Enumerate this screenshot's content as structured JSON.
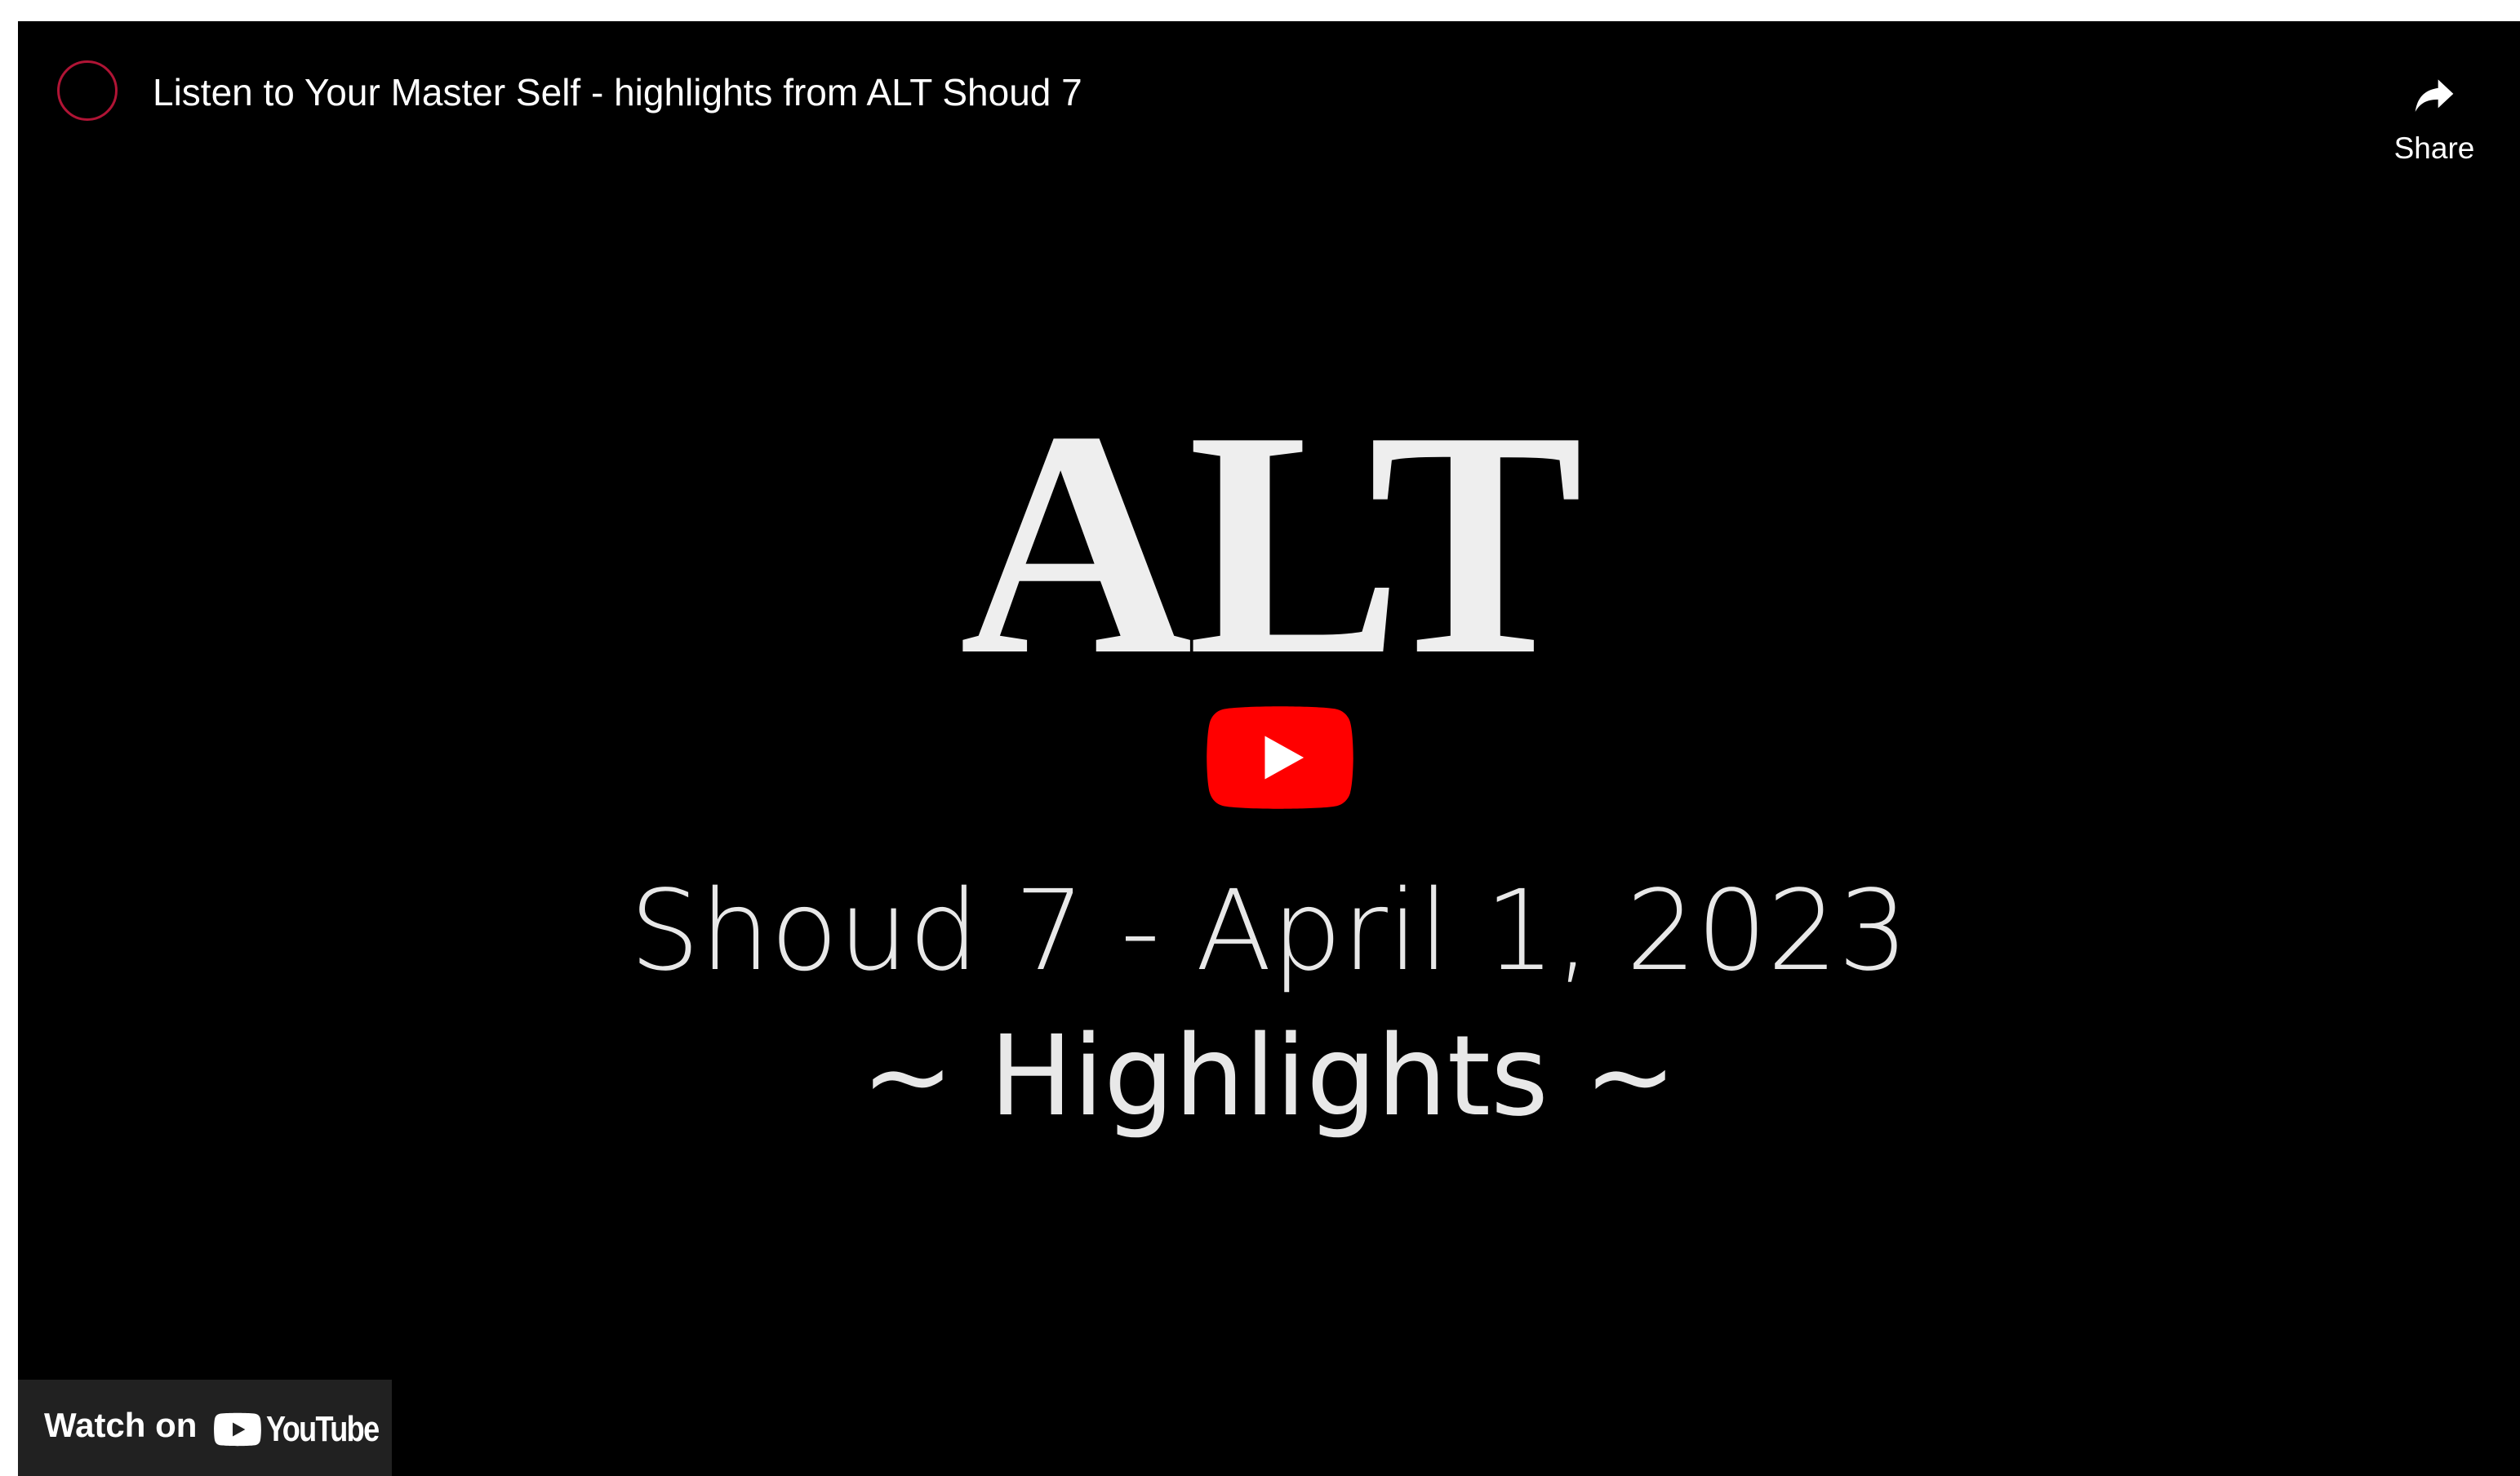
{
  "player": {
    "title": "Listen to Your Master Self - highlights from ALT Shoud 7",
    "share_label": "Share",
    "watch_on_label": "Watch on",
    "youtube_wordmark": "YouTube"
  },
  "thumbnail": {
    "logo_text": "ALT",
    "subtitle": "Shoud 7 - April 1, 2023",
    "highlights": "~ Highlights ~"
  },
  "icons": {
    "avatar": "channel-avatar-icon",
    "share": "share-arrow-icon",
    "play": "play-icon",
    "youtube": "youtube-logo-icon"
  },
  "colors": {
    "background": "#000000",
    "play_red": "#ff0000",
    "avatar_ring": "#b01435",
    "watch_on_bg": "#212121"
  }
}
